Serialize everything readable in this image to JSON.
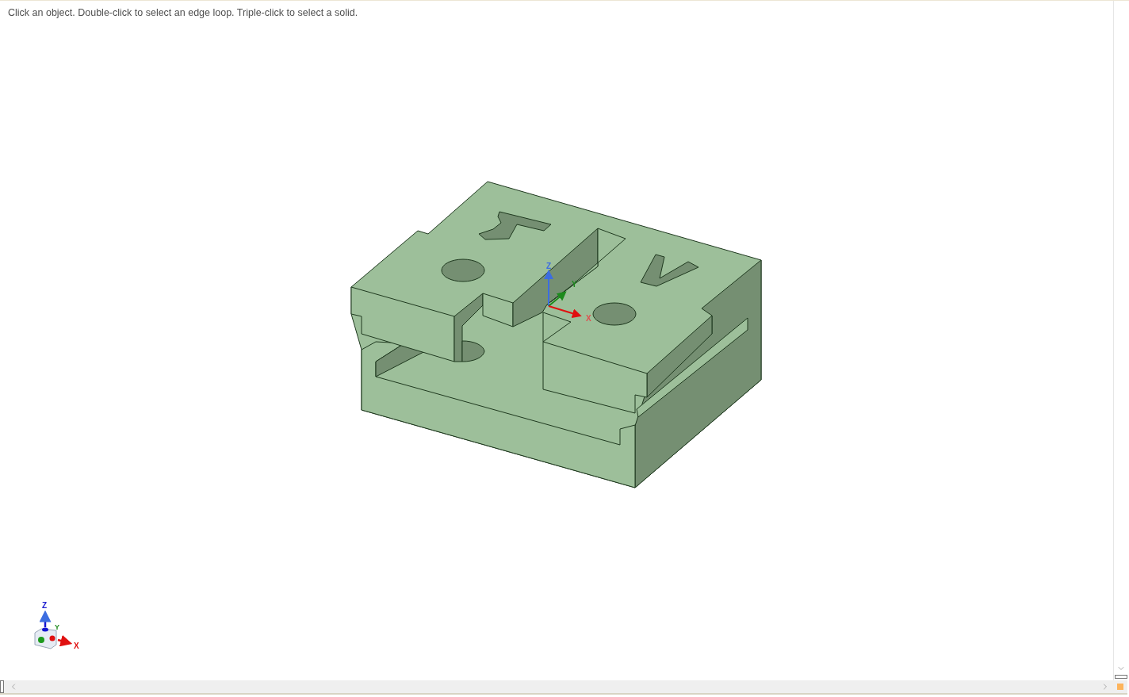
{
  "hint": "Click an object. Double-click to select an edge loop. Triple-click to select a solid.",
  "model_triad": {
    "x": "X",
    "y": "Y",
    "z": "Z"
  },
  "view_triad": {
    "x": "X",
    "y": "Y",
    "z": "Z"
  }
}
